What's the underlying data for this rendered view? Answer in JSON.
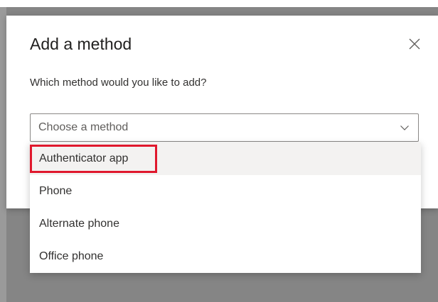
{
  "dialog": {
    "title": "Add a method",
    "question": "Which method would you like to add?",
    "close_icon": "close-icon",
    "select": {
      "value": "Choose a method",
      "icon": "chevron-down-icon"
    },
    "options": [
      {
        "label": "Authenticator app",
        "highlighted": true
      },
      {
        "label": "Phone",
        "highlighted": false
      },
      {
        "label": "Alternate phone",
        "highlighted": false
      },
      {
        "label": "Office phone",
        "highlighted": false
      }
    ]
  },
  "colors": {
    "overlay": "#858585",
    "highlight": "#e0182d",
    "hover": "#f3f2f1"
  }
}
